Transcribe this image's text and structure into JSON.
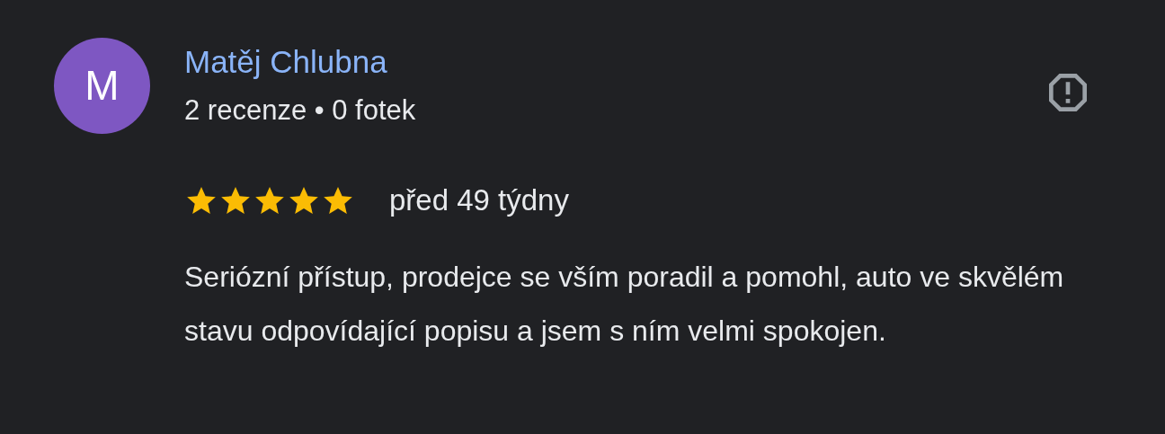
{
  "review": {
    "avatar_letter": "M",
    "author": "Matěj Chlubna",
    "author_meta": "2 recenze • 0 fotek",
    "stars": 5,
    "time": "před 49 týdny",
    "text": "Seriózní přístup, prodejce se vším poradil a pomohl, auto ve skvělém stavu odpovídající popisu a jsem s ním velmi spokojen."
  }
}
